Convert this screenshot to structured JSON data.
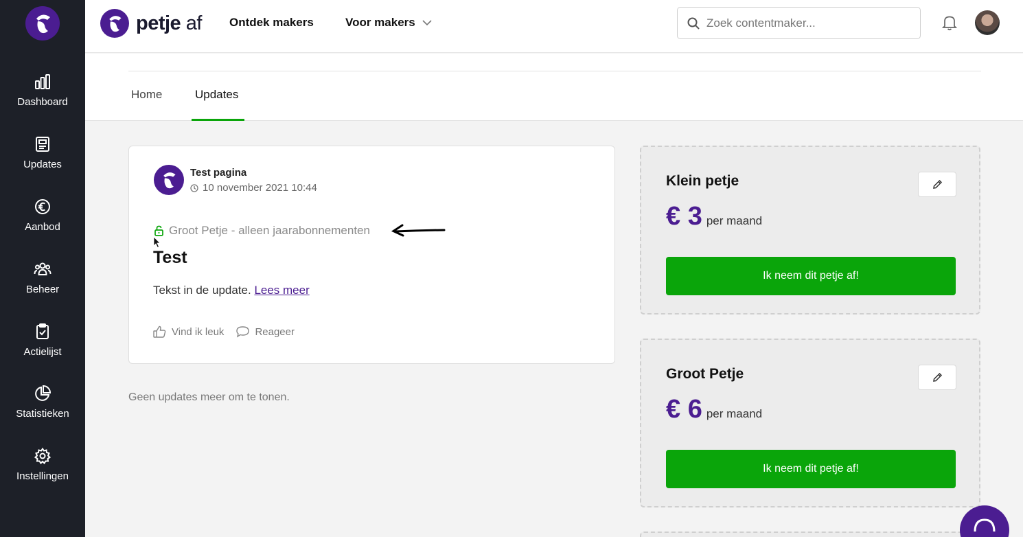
{
  "sidebar": {
    "items": [
      {
        "label": "Dashboard",
        "icon": "bar-chart-icon"
      },
      {
        "label": "Updates",
        "icon": "newspaper-icon"
      },
      {
        "label": "Aanbod",
        "icon": "euro-icon"
      },
      {
        "label": "Beheer",
        "icon": "users-icon"
      },
      {
        "label": "Actielijst",
        "icon": "clipboard-check-icon"
      },
      {
        "label": "Statistieken",
        "icon": "pie-chart-icon"
      },
      {
        "label": "Instellingen",
        "icon": "gear-icon"
      }
    ]
  },
  "header": {
    "brand_bold": "petje",
    "brand_light": " af",
    "nav": {
      "discover": "Ontdek makers",
      "for_makers": "Voor makers"
    },
    "search": {
      "placeholder": "Zoek contentmaker..."
    }
  },
  "tabs": {
    "home": "Home",
    "updates": "Updates"
  },
  "post": {
    "author": "Test pagina",
    "date": "10 november 2021 10:44",
    "tier": "Groot Petje - alleen jaarabonnementen",
    "title": "Test",
    "body": "Tekst in de update. ",
    "read_more": "Lees meer",
    "like": "Vind ik leuk",
    "reply": "Reageer"
  },
  "no_more_updates": "Geen updates meer om te tonen.",
  "tiers": [
    {
      "name": "Klein petje",
      "amount": "€ 3",
      "period": "per maand",
      "cta": "Ik neem dit petje af!"
    },
    {
      "name": "Groot Petje",
      "amount": "€ 6",
      "period": "per maand",
      "cta": "Ik neem dit petje af!"
    }
  ],
  "colors": {
    "brand_purple": "#4b1d91",
    "cta_green": "#0aa50a",
    "sidebar_bg": "#1d2028"
  }
}
